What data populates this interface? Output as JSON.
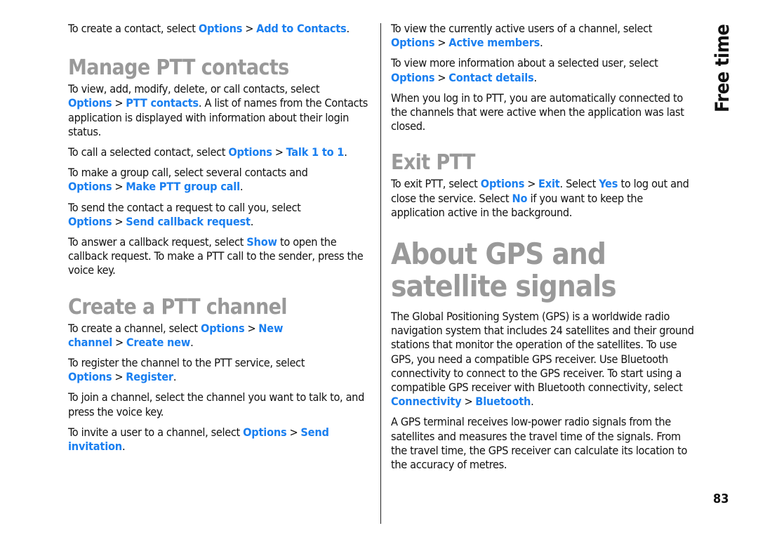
{
  "side_label": "Free time",
  "page_number": "83",
  "left": {
    "intro": {
      "text1": "To create a contact, select ",
      "link1": "Options",
      "link2": "Add to Contacts",
      "end": "."
    },
    "manage": {
      "heading": "Manage PTT contacts",
      "p1": {
        "text1": "To view, add, modify, delete, or call contacts, select ",
        "link1": "Options",
        "link2": "PTT contacts",
        "text2": ". A list of names from the Contacts application is displayed with information about their login status."
      },
      "p2": {
        "text1": "To call a selected contact, select ",
        "link1": "Options",
        "link2": "Talk 1 to 1",
        "end": "."
      },
      "p3": {
        "text1": "To make a group call, select several contacts and ",
        "link1": "Options",
        "link2": "Make PTT group call",
        "end": "."
      },
      "p4": {
        "text1": "To send the contact a request to call you, select ",
        "link1": "Options",
        "link2": "Send callback request",
        "end": "."
      },
      "p5": {
        "text1": "To answer a callback request, select ",
        "link1": "Show",
        "text2": " to open the callback request. To make a PTT call to the sender, press the voice key."
      }
    },
    "create": {
      "heading": "Create a PTT channel",
      "p1": {
        "text1": "To create a channel, select ",
        "link1": "Options",
        "link2": "New channel",
        "link3": "Create new",
        "end": "."
      },
      "p2": {
        "text1": "To register the channel to the PTT service, select ",
        "link1": "Options",
        "link2": "Register",
        "end": "."
      },
      "p3": {
        "text1": "To join a channel, select the channel you want to talk to, and press the voice key."
      },
      "p4": {
        "text1": "To invite a user to a channel, select ",
        "link1": "Options",
        "link2": "Send invitation",
        "end": "."
      }
    }
  },
  "right": {
    "p1": {
      "text1": "To view the currently active users of a channel, select ",
      "link1": "Options",
      "link2": "Active members",
      "end": "."
    },
    "p2": {
      "text1": "To view more information about a selected user, select ",
      "link1": "Options",
      "link2": "Contact details",
      "end": "."
    },
    "p3": {
      "text1": "When you log in to PTT, you are automatically connected to the channels that were active when the application was last closed."
    },
    "exit": {
      "heading": "Exit PTT",
      "p1": {
        "text1": "To exit PTT, select ",
        "link1": "Options",
        "link2": "Exit",
        "text2": ". Select ",
        "link3": "Yes",
        "text3": " to log out and close the service. Select ",
        "link4": "No",
        "text4": " if you want to keep the application active in the background."
      }
    },
    "gps": {
      "heading": "About GPS and satellite signals",
      "p1": {
        "text1": "The Global Positioning System (GPS) is a worldwide radio navigation system that includes 24 satellites and their ground stations that monitor the operation of the satellites. To use GPS, you need a compatible GPS receiver. Use Bluetooth connectivity to connect to the GPS receiver. To start using a compatible GPS receiver with Bluetooth connectivity, select ",
        "link1": "Connectivity",
        "link2": "Bluetooth",
        "end": "."
      },
      "p2": {
        "text1": "A GPS terminal receives low-power radio signals from the satellites and measures the travel time of the signals. From the travel time, the GPS receiver can calculate its location to the accuracy of metres."
      }
    }
  },
  "menu_separator": ">",
  "colors": {
    "link": "#1a7ff0",
    "heading": "#999999",
    "text": "#111111"
  }
}
